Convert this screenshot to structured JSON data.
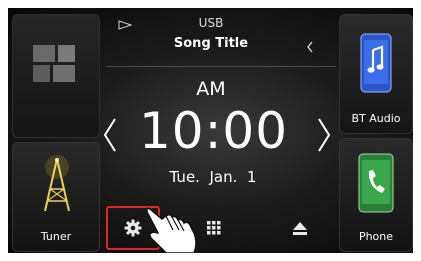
{
  "source": {
    "label": "USB",
    "track_title": "Song Title"
  },
  "clock": {
    "am_pm": "AM",
    "time": "10:00",
    "date": "Tue.  Jan.  1"
  },
  "tiles": {
    "bt_audio": "BT Audio",
    "tuner": "Tuner",
    "phone": "Phone"
  },
  "colors": {
    "highlight": "#e02430",
    "bt_accent": "#3b6ee8",
    "phone_accent": "#3aa84a",
    "tuner_accent": "#c9b23a"
  },
  "icons": {
    "grid_tile": "grid-icon",
    "bt_audio": "music-phone-icon",
    "tuner": "radio-tower-icon",
    "phone": "phone-icon",
    "settings": "gear-icon",
    "menu": "grid-menu-icon",
    "eject": "eject-icon",
    "source_play": "play-outline-icon",
    "tap_hand": "hand-pointer-icon"
  }
}
